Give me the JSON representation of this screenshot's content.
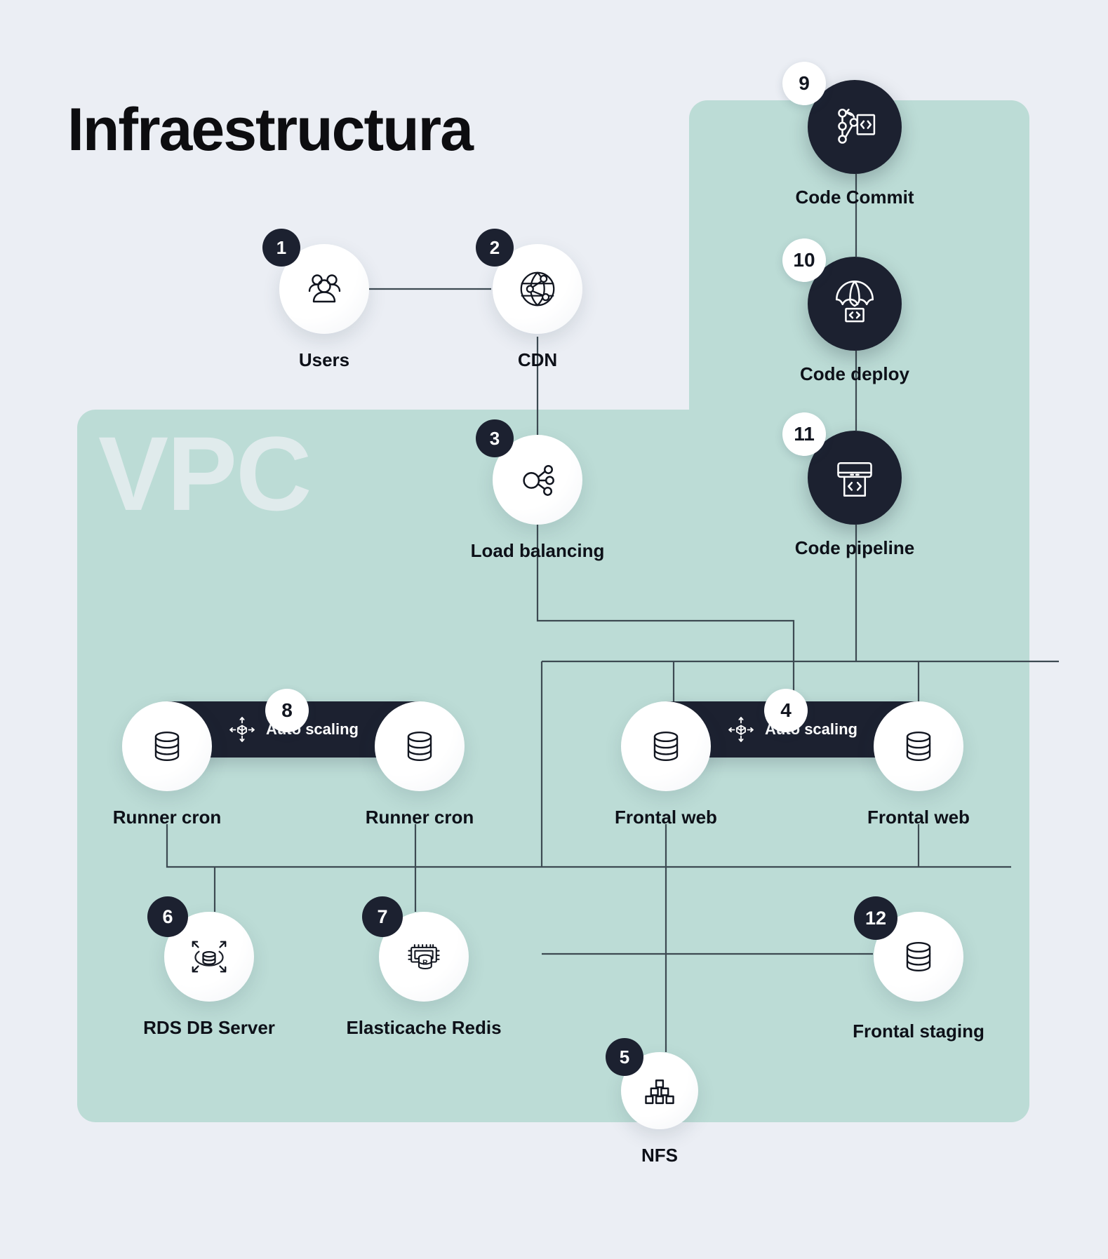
{
  "title": "Infraestructura",
  "watermark": "VPC",
  "colors": {
    "background": "#ebeef4",
    "panel_mint": "#bcdcd6",
    "dark": "#1c2130",
    "node_light": "#ffffff",
    "wire": "#3d4a52",
    "watermark": "#e7eef1"
  },
  "autoscaling_groups": [
    {
      "badge": "8",
      "label": "Auto scaling",
      "icon": "auto-scaling-icon"
    },
    {
      "badge": "4",
      "label": "Auto scaling",
      "icon": "auto-scaling-icon"
    }
  ],
  "nodes": [
    {
      "num": "1",
      "label": "Users",
      "icon": "users-icon",
      "style": "light",
      "badge": "dark"
    },
    {
      "num": "2",
      "label": "CDN",
      "icon": "globe-network-icon",
      "style": "light",
      "badge": "dark"
    },
    {
      "num": "3",
      "label": "Load balancing",
      "icon": "load-balancer-icon",
      "style": "light",
      "badge": "dark"
    },
    {
      "num": "4",
      "label": "Frontal web",
      "icon": "database-icon",
      "style": "light",
      "badge": "light"
    },
    {
      "num": "5",
      "label": "NFS",
      "icon": "nfs-stack-icon",
      "style": "light",
      "badge": "dark"
    },
    {
      "num": "6",
      "label": "RDS DB Server",
      "icon": "rds-scale-icon",
      "style": "light",
      "badge": "dark"
    },
    {
      "num": "7",
      "label": "Elasticache Redis",
      "icon": "redis-chip-icon",
      "style": "light",
      "badge": "dark"
    },
    {
      "num": "8",
      "label": "Runner cron",
      "icon": "database-icon",
      "style": "light",
      "badge": "light"
    },
    {
      "num": "9",
      "label": "Code Commit",
      "icon": "code-commit-icon",
      "style": "dark",
      "badge": "light"
    },
    {
      "num": "10",
      "label": "Code deploy",
      "icon": "code-deploy-icon",
      "style": "dark",
      "badge": "light"
    },
    {
      "num": "11",
      "label": "Code pipeline",
      "icon": "code-pipeline-icon",
      "style": "dark",
      "badge": "light"
    },
    {
      "num": "12",
      "label": "Frontal staging",
      "icon": "database-icon",
      "style": "light",
      "badge": "dark"
    }
  ],
  "labels": {
    "users": "Users",
    "cdn": "CDN",
    "load_balancing": "Load balancing",
    "runner_cron_left": "Runner cron",
    "runner_cron_right": "Runner cron",
    "frontal_web_left": "Frontal web",
    "frontal_web_right": "Frontal web",
    "rds": "RDS DB Server",
    "redis": "Elasticache Redis",
    "nfs": "NFS",
    "frontal_staging": "Frontal staging",
    "code_commit": "Code Commit",
    "code_deploy": "Code deploy",
    "code_pipeline": "Code pipeline",
    "auto_scaling_left": "Auto scaling",
    "auto_scaling_right": "Auto scaling"
  },
  "badges": {
    "users": "1",
    "cdn": "2",
    "load_balancing": "3",
    "autoscaling_right": "4",
    "nfs": "5",
    "rds": "6",
    "redis": "7",
    "autoscaling_left": "8",
    "code_commit": "9",
    "code_deploy": "10",
    "code_pipeline": "11",
    "frontal_staging": "12"
  }
}
